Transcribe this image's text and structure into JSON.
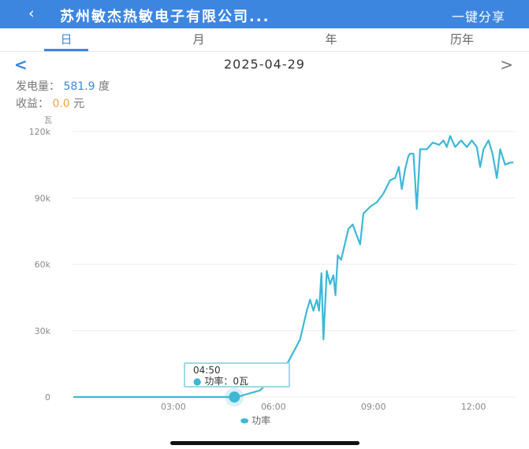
{
  "header": {
    "back_icon": "‹",
    "title": "苏州敏杰热敏电子有限公司...",
    "share": "一键分享"
  },
  "tabs": [
    "日",
    "月",
    "年",
    "历年"
  ],
  "active_tab": 0,
  "date_nav": {
    "prev": "<",
    "date": "2025-04-29",
    "next": ">"
  },
  "stats": {
    "gen_label": "发电量：",
    "gen_value": "581.9",
    "gen_unit": "度",
    "income_label": "收益：",
    "income_value": "0.0",
    "income_unit": "元"
  },
  "colors": {
    "brand": "#3d86e0",
    "line": "#3db8d6",
    "income": "#f0a33a"
  },
  "tooltip": {
    "time": "04:50",
    "label": "功率：",
    "value": "0瓦"
  },
  "chart_data": {
    "type": "line",
    "ylabel": "瓦",
    "y_ticks": [
      "0",
      "30k",
      "60k",
      "90k",
      "120k"
    ],
    "ylim": [
      0,
      120000
    ],
    "x_ticks": [
      "03:00",
      "06:00",
      "09:00",
      "12:00"
    ],
    "xlim_hours": [
      0,
      13.3
    ],
    "legend": "功率",
    "series": [
      {
        "name": "功率",
        "x_hours": [
          0,
          4.9,
          5.6,
          6.45,
          6.8,
          7.0,
          7.1,
          7.2,
          7.3,
          7.37,
          7.44,
          7.5,
          7.6,
          7.7,
          7.8,
          7.86,
          7.93,
          8.03,
          8.14,
          8.25,
          8.38,
          8.5,
          8.6,
          8.7,
          8.9,
          9.1,
          9.3,
          9.5,
          9.65,
          9.76,
          9.85,
          9.95,
          10.05,
          10.1,
          10.2,
          10.3,
          10.4,
          10.6,
          10.78,
          10.97,
          11.1,
          11.2,
          11.3,
          11.45,
          11.63,
          11.8,
          11.95,
          12.1,
          12.2,
          12.3,
          12.45,
          12.57,
          12.7,
          12.8,
          12.95,
          13.1,
          13.2
        ],
        "values_k": [
          0,
          0,
          3,
          16,
          26,
          39,
          44,
          39,
          44,
          39,
          56,
          26,
          57,
          51,
          55,
          46,
          64,
          62,
          69,
          76,
          78,
          73,
          69,
          83,
          86,
          88,
          92,
          98,
          99,
          104,
          94,
          103,
          109,
          110,
          110,
          85,
          112,
          112,
          115,
          114,
          116,
          113,
          118,
          113,
          116,
          113,
          116,
          113,
          104,
          112,
          116,
          110,
          99,
          112,
          105,
          106,
          106
        ]
      }
    ]
  }
}
